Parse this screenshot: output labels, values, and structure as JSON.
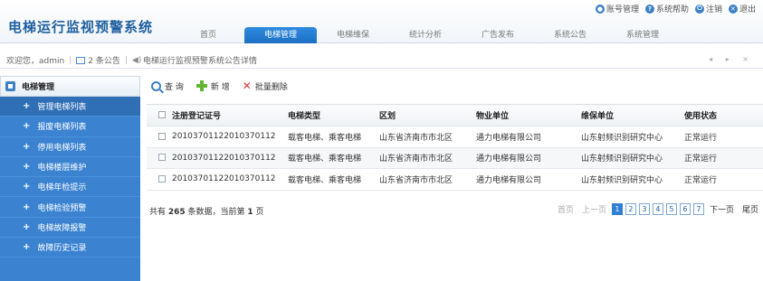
{
  "app": {
    "title": "电梯运行监视预警系统"
  },
  "top_links": [
    {
      "label": "账号管理",
      "icon": "user-icon",
      "color": "#3b7fc6"
    },
    {
      "label": "系统帮助",
      "icon": "help-icon",
      "color": "#3b7fc6"
    },
    {
      "label": "注销",
      "icon": "power-icon",
      "color": "#3b7fc6"
    },
    {
      "label": "退出",
      "icon": "close-icon",
      "color": "#3b7fc6"
    }
  ],
  "nav": {
    "tabs": [
      {
        "label": "首页"
      },
      {
        "label": "电梯管理"
      },
      {
        "label": "电梯维保"
      },
      {
        "label": "统计分析"
      },
      {
        "label": "广告发布"
      },
      {
        "label": "系统公告"
      },
      {
        "label": "系统管理"
      }
    ],
    "active_index": 1
  },
  "notice_bar": {
    "welcome": "欢迎您，admin",
    "announcement_count": "2 条公告",
    "notice_link": "电梯运行监视预警系统公告详情",
    "controls": "◂ ▸ ×"
  },
  "sidebar": {
    "header": "电梯管理",
    "items": [
      {
        "label": "管理电梯列表"
      },
      {
        "label": "报废电梯列表"
      },
      {
        "label": "停用电梯列表"
      },
      {
        "label": "电梯楼层维护"
      },
      {
        "label": "电梯年检提示"
      },
      {
        "label": "电梯检验预警"
      },
      {
        "label": "电梯故障报警"
      },
      {
        "label": "故障历史记录"
      }
    ],
    "active_index": 0
  },
  "toolbar": {
    "query": "查 询",
    "add": "新 增",
    "batch_delete": "批量删除"
  },
  "table": {
    "headers": [
      "注册登记证号",
      "电梯类型",
      "区划",
      "物业单位",
      "维保单位",
      "使用状态"
    ],
    "rows": [
      [
        "20103701122010370112",
        "载客电梯、乘客电梯",
        "山东省济南市市北区",
        "通力电梯有限公司",
        "山东射频识别研究中心",
        "正常运行"
      ],
      [
        "20103701122010370112",
        "载客电梯、乘客电梯",
        "山东省济南市市北区",
        "通力电梯有限公司",
        "山东射频识别研究中心",
        "正常运行"
      ],
      [
        "20103701122010370112",
        "载客电梯、乘客电梯",
        "山东省济南市市北区",
        "通力电梯有限公司",
        "山东射频识别研究中心",
        "正常运行"
      ]
    ]
  },
  "pager": {
    "prefix": "共有 ",
    "total": "265",
    "middle": " 条数据，当前第 ",
    "current": "1",
    "suffix": " 页",
    "first": "首页",
    "prev": "上一页",
    "pages": [
      "1",
      "2",
      "3",
      "4",
      "5",
      "6",
      "7"
    ],
    "next": "下一页",
    "last": "尾页"
  }
}
